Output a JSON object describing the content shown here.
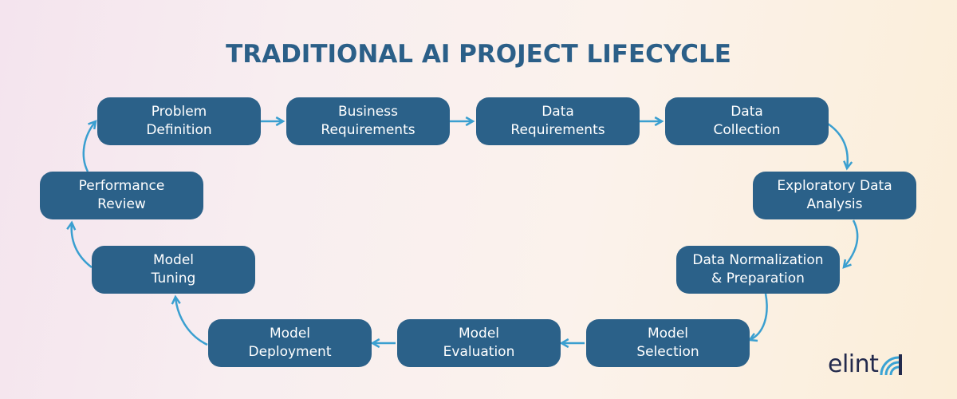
{
  "title": "TRADITIONAL AI PROJECT LIFECYCLE",
  "colors": {
    "node_fill": "#2b6189",
    "node_text": "#ffffff",
    "arrow": "#3a9fd0",
    "title": "#2b5f88",
    "logo_text": "#232a4d"
  },
  "nodes": [
    {
      "id": "problem-definition",
      "label": "Problem\nDefinition"
    },
    {
      "id": "business-requirements",
      "label": "Business\nRequirements"
    },
    {
      "id": "data-requirements",
      "label": "Data\nRequirements"
    },
    {
      "id": "data-collection",
      "label": "Data\nCollection"
    },
    {
      "id": "exploratory-data-analysis",
      "label": "Exploratory Data\nAnalysis"
    },
    {
      "id": "data-normalization-preparation",
      "label": "Data Normalization\n& Preparation"
    },
    {
      "id": "model-selection",
      "label": "Model\nSelection"
    },
    {
      "id": "model-evaluation",
      "label": "Model\nEvaluation"
    },
    {
      "id": "model-deployment",
      "label": "Model\nDeployment"
    },
    {
      "id": "model-tuning",
      "label": "Model\nTuning"
    },
    {
      "id": "performance-review",
      "label": "Performance\nReview"
    }
  ],
  "edges": [
    [
      "problem-definition",
      "business-requirements"
    ],
    [
      "business-requirements",
      "data-requirements"
    ],
    [
      "data-requirements",
      "data-collection"
    ],
    [
      "data-collection",
      "exploratory-data-analysis"
    ],
    [
      "exploratory-data-analysis",
      "data-normalization-preparation"
    ],
    [
      "data-normalization-preparation",
      "model-selection"
    ],
    [
      "model-selection",
      "model-evaluation"
    ],
    [
      "model-evaluation",
      "model-deployment"
    ],
    [
      "model-deployment",
      "model-tuning"
    ],
    [
      "model-tuning",
      "performance-review"
    ],
    [
      "performance-review",
      "problem-definition"
    ]
  ],
  "logo": {
    "text": "elint",
    "icon": "signal-waves-icon"
  }
}
